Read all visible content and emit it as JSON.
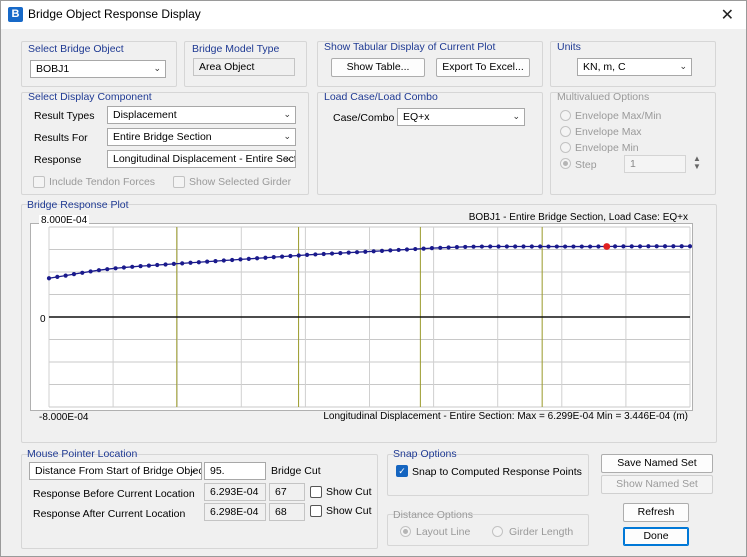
{
  "window": {
    "title": "Bridge Object Response Display",
    "app_icon": "B",
    "close_glyph": "✕"
  },
  "select_bridge_object": {
    "label": "Select Bridge Object",
    "value": "BOBJ1"
  },
  "bridge_model_type": {
    "label": "Bridge Model Type",
    "value": "Area Object"
  },
  "tabular": {
    "label": "Show Tabular Display of Current Plot",
    "show_table": "Show Table...",
    "export_excel": "Export To Excel..."
  },
  "units": {
    "label": "Units",
    "value": "KN, m, C"
  },
  "display_component": {
    "label": "Select Display Component",
    "result_types_label": "Result Types",
    "result_types_value": "Displacement",
    "results_for_label": "Results For",
    "results_for_value": "Entire Bridge Section",
    "response_label": "Response",
    "response_value": "Longitudinal Displacement - Entire Section",
    "include_tendon": "Include Tendon Forces",
    "show_girder": "Show Selected Girder"
  },
  "load_case": {
    "label": "Load Case/Load Combo",
    "case_label": "Case/Combo",
    "case_value": "EQ+x"
  },
  "multivalued": {
    "label": "Multivalued Options",
    "env_maxmin": "Envelope Max/Min",
    "env_max": "Envelope Max",
    "env_min": "Envelope Min",
    "step": "Step",
    "step_value": "1"
  },
  "plot": {
    "label": "Bridge Response Plot",
    "top_label": "8.000E-04",
    "zero_label": "0",
    "bottom_label": "-8.000E-04",
    "header": "BOBJ1 - Entire Bridge Section,  Load Case: EQ+x",
    "footer": "Longitudinal Displacement - Entire Section:  Max = 6.299E-04   Min = 3.446E-04  (m)"
  },
  "chart_data": {
    "type": "line",
    "title": "BOBJ1 - Entire Bridge Section,  Load Case: EQ+x",
    "ylabel": "Longitudinal Displacement - Entire Section (m)",
    "ylim": [
      -0.0008,
      0.0008
    ],
    "grid": true,
    "series": [
      {
        "name": "Longitudinal Displacement - Entire Section",
        "color": "#1a1a8c",
        "values": [
          0.0003446,
          0.000357,
          0.000368,
          0.000381,
          0.000393,
          0.000405,
          0.000416,
          0.000425,
          0.000433,
          0.00044,
          0.000446,
          0.000452,
          0.000457,
          0.000462,
          0.000467,
          0.000472,
          0.000477,
          0.000482,
          0.000487,
          0.000492,
          0.000497,
          0.000502,
          0.000507,
          0.000512,
          0.000517,
          0.000522,
          0.000527,
          0.000532,
          0.000537,
          0.000542,
          0.000547,
          0.000552,
          0.000556,
          0.00056,
          0.000564,
          0.000568,
          0.000572,
          0.000576,
          0.00058,
          0.000584,
          0.000588,
          0.000592,
          0.000596,
          0.0006,
          0.000604,
          0.000608,
          0.000612,
          0.000615,
          0.000618,
          0.000621,
          0.000623,
          0.000625,
          0.000626,
          0.000627,
          0.000627,
          0.000627,
          0.000627,
          0.000627,
          0.000627,
          0.000627,
          0.000626,
          0.000626,
          0.000626,
          0.000626,
          0.000626,
          0.000626,
          0.000627,
          0.000627,
          0.000628,
          0.000628,
          0.000628,
          0.000628,
          0.000629,
          0.000629,
          0.000629,
          0.000629,
          0.000629,
          0.000629
        ]
      }
    ],
    "highlight_index": 67,
    "highlight_color": "#e02020",
    "vertical_markers": [
      0.19,
      0.38,
      0.57,
      0.76
    ],
    "marker_color": "#9a9a2a"
  },
  "mouse_pointer": {
    "label": "Mouse Pointer Location",
    "mode_value": "Distance From Start of Bridge Object",
    "distance_value": "95.",
    "bridge_cut_label": "Bridge Cut",
    "before_label": "Response Before Current Location",
    "before_value": "6.293E-04",
    "before_cut": "67",
    "after_label": "Response After Current Location",
    "after_value": "6.298E-04",
    "after_cut": "68",
    "show_cut": "Show Cut"
  },
  "snap_options": {
    "label": "Snap Options",
    "snap_label": "Snap to Computed Response Points",
    "snap_checked": true
  },
  "distance_options": {
    "label": "Distance Options",
    "layout_line": "Layout Line",
    "girder_length": "Girder Length"
  },
  "actions": {
    "save_named_set": "Save Named Set",
    "show_named_set": "Show Named Set",
    "refresh": "Refresh",
    "done": "Done"
  }
}
